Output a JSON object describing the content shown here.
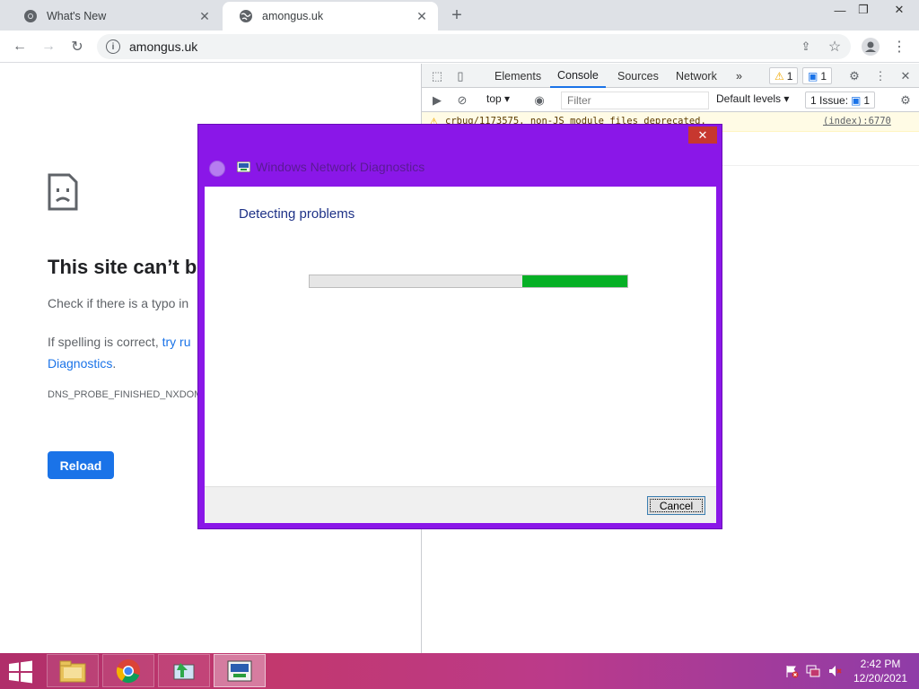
{
  "browser": {
    "tabs": [
      {
        "label": "What's New",
        "icon": "chrome-icon",
        "active": false
      },
      {
        "label": "amongus.uk",
        "icon": "globe-icon",
        "active": true
      }
    ],
    "address": "amongus.uk"
  },
  "error_page": {
    "title": "This site can’t b",
    "check_text": "Check if there is a typo in",
    "spelling_prefix": "If spelling is correct, ",
    "spelling_link": "try ru",
    "spelling_link2": "Diagnostics",
    "spelling_suffix": ".",
    "error_code": "DNS_PROBE_FINISHED_NXDOM",
    "reload_label": "Reload"
  },
  "devtools": {
    "tabs": [
      "Elements",
      "Console",
      "Sources",
      "Network"
    ],
    "active_tab": "Console",
    "more": "»",
    "warnings_count": "1",
    "messages_count": "1",
    "context": "top",
    "filter_placeholder": "Filter",
    "levels": "Default levels",
    "issues_label": "1 Issue:",
    "issues_count": "1",
    "console_message": "crbug/1173575, non-JS module files deprecated.",
    "console_source": "(index):6770"
  },
  "dialog": {
    "title": "Windows Network Diagnostics",
    "heading": "Detecting problems",
    "progress": 0.33,
    "cancel_label": "Cancel",
    "colors": {
      "frame": "#8a17e8",
      "progress": "#06b025"
    }
  },
  "taskbar": {
    "time": "2:42 PM",
    "date": "12/20/2021"
  }
}
